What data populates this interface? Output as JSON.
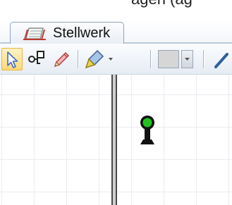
{
  "window": {
    "partial_caption": "agen (ag"
  },
  "tabs": [
    {
      "label": "Stellwerk",
      "icon": "stellwerk-tab-icon",
      "active": true
    }
  ],
  "toolbar": {
    "tools": [
      {
        "name": "select-tool",
        "icon": "arrow-pointer-icon",
        "active": true
      },
      {
        "name": "connect-tool",
        "icon": "node-link-icon"
      },
      {
        "name": "pencil-tool",
        "icon": "pencil-icon"
      },
      {
        "name": "fill-tool",
        "icon": "paint-brush-icon",
        "has_dropdown": true
      },
      {
        "name": "color-picker",
        "icon": "color-swatch",
        "color": "#d6d6d6",
        "has_dropdown": true
      },
      {
        "name": "line-tool",
        "icon": "line-icon"
      }
    ]
  },
  "canvas": {
    "grid": true,
    "elements": [
      {
        "type": "track",
        "orientation": "vertical",
        "color": "#4a4a4a"
      },
      {
        "type": "signal",
        "aspect": "green",
        "color": "#22c21e"
      }
    ]
  }
}
